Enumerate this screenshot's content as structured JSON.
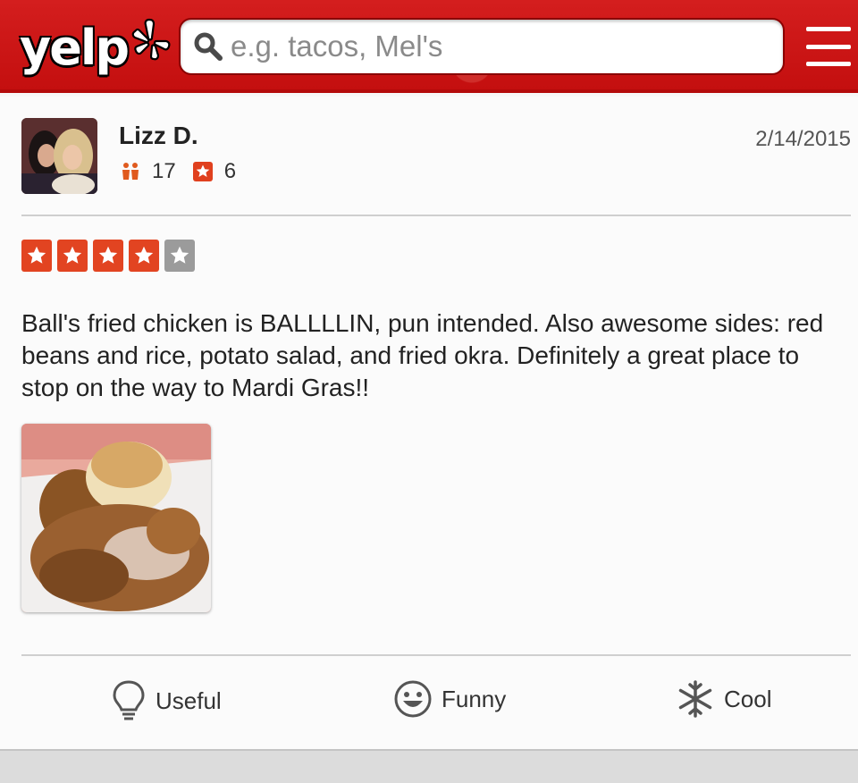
{
  "header": {
    "logo_text": "yelp",
    "search_placeholder": "e.g. tacos, Mel's",
    "brand_color": "#d32323"
  },
  "review": {
    "user_name": "Lizz D.",
    "friends_count": "17",
    "reviews_count": "6",
    "date": "2/14/2015",
    "rating": 4,
    "rating_max": 5,
    "text": "Ball's fried chicken is BALLLLIN, pun intended. Also awesome sides: red beans and rice, potato salad, and fried okra. Definitely a great place to stop on the way to Mardi Gras!!"
  },
  "actions": {
    "useful_label": "Useful",
    "funny_label": "Funny",
    "cool_label": "Cool"
  }
}
